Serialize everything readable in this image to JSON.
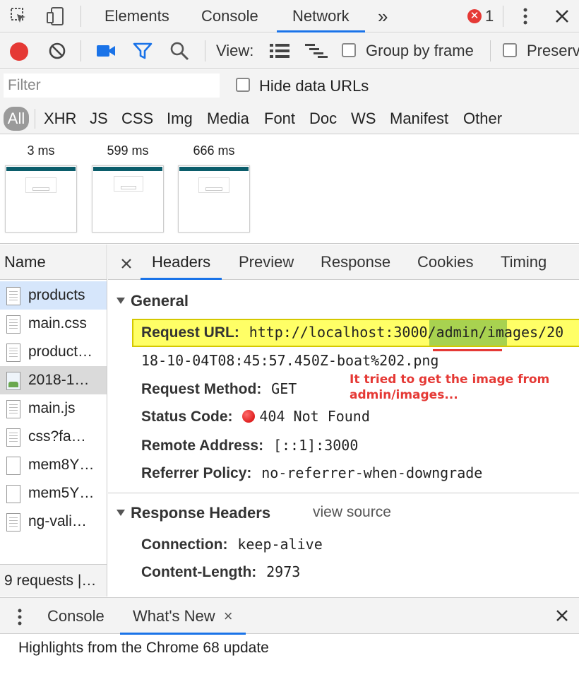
{
  "top_tabs": [
    "Elements",
    "Console",
    "Network"
  ],
  "active_top_tab": "Network",
  "more_tabs_glyph": "»",
  "error_count": "1",
  "toolbar": {
    "view_label": "View:",
    "group_by_frame": "Group by frame",
    "preserve_log": "Preserv"
  },
  "filter": {
    "placeholder": "Filter",
    "hide_data_urls": "Hide data URLs"
  },
  "type_filters": [
    "All",
    "XHR",
    "JS",
    "CSS",
    "Img",
    "Media",
    "Font",
    "Doc",
    "WS",
    "Manifest",
    "Other"
  ],
  "filmstrip": [
    "3 ms",
    "599 ms",
    "666 ms"
  ],
  "requests": {
    "header": "Name",
    "items": [
      "products",
      "main.css",
      "product…",
      "2018-1…",
      "main.js",
      "css?fa…",
      "mem8Y…",
      "mem5Y…",
      "ng-vali…"
    ],
    "summary": "9 requests |…"
  },
  "detail_tabs": [
    "Headers",
    "Preview",
    "Response",
    "Cookies",
    "Timing"
  ],
  "general": {
    "title": "General",
    "request_url_label": "Request URL:",
    "request_url_line1": "http://localhost:3000/admin/images/20",
    "request_url_line2": "18-10-04T08:45:57.450Z-boat%202.png",
    "request_method_label": "Request Method:",
    "request_method": "GET",
    "status_code_label": "Status Code:",
    "status_code": "404 Not Found",
    "remote_address_label": "Remote Address:",
    "remote_address": "[::1]:3000",
    "referrer_policy_label": "Referrer Policy:",
    "referrer_policy": "no-referrer-when-downgrade"
  },
  "annotation": "It tried to get the image from admin/images...",
  "response_headers": {
    "title": "Response Headers",
    "view_source": "view source",
    "connection_label": "Connection:",
    "connection": "keep-alive",
    "content_length_label": "Content-Length:",
    "content_length": "2973"
  },
  "drawer": {
    "tabs": [
      "Console",
      "What's New"
    ],
    "close_glyph": "×",
    "highlights": "Highlights from the Chrome 68 update"
  },
  "colors": {
    "accent": "#1a73e8",
    "record": "#e53935",
    "highlight": "#ffff66",
    "annotation": "#e53935"
  }
}
